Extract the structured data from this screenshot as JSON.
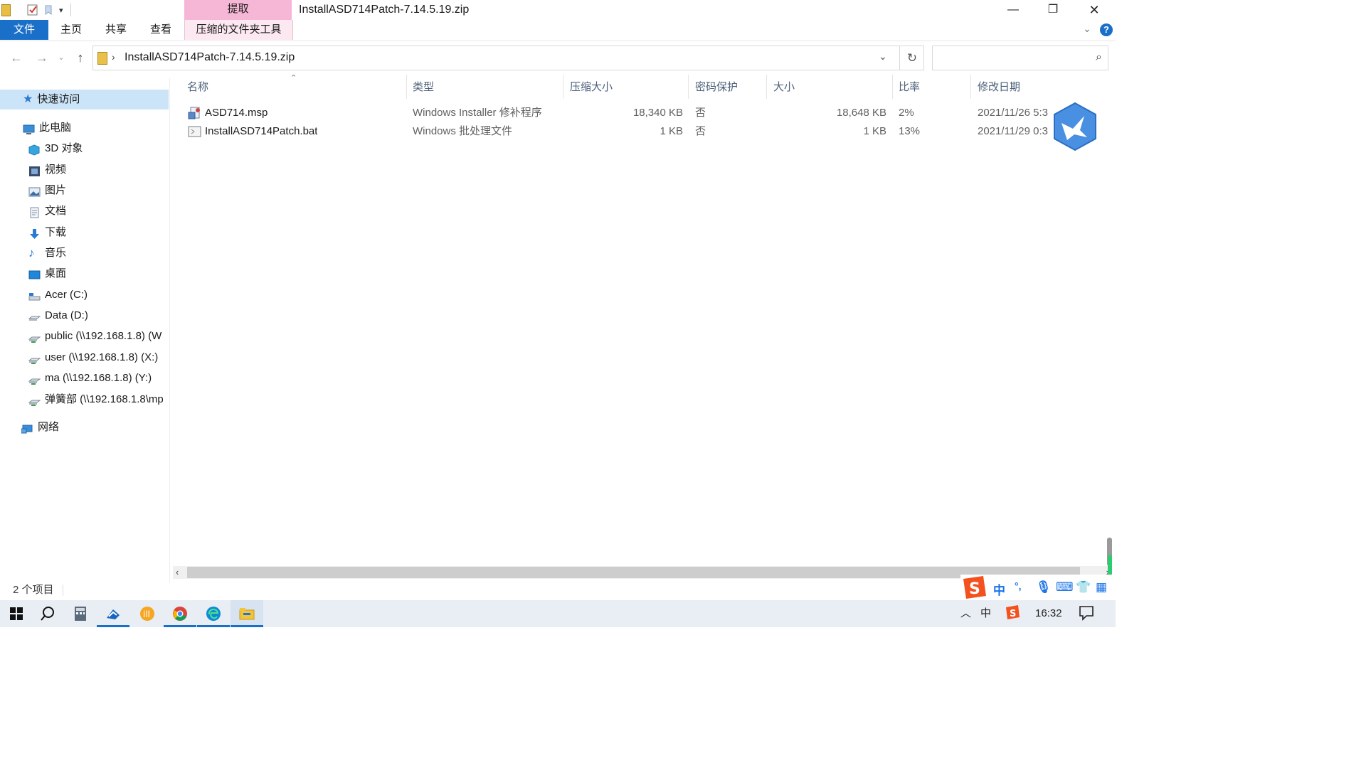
{
  "window": {
    "title": "InstallASD714Patch-7.14.5.19.zip",
    "context_tab_group": "提取",
    "controls": [
      "—",
      "❐",
      "✕"
    ]
  },
  "ribbon": {
    "tabs": [
      "文件",
      "主页",
      "共享",
      "查看",
      "压缩的文件夹工具"
    ],
    "active_tab": "文件",
    "context_color": "#f6b7d6",
    "accent": "#1a6fc9"
  },
  "navigation": {
    "address_path": "InstallASD714Patch-7.14.5.19.zip",
    "search_placeholder": ""
  },
  "sidebar": {
    "quick_access": "快速访问",
    "this_pc": "此电脑",
    "items": [
      {
        "label": "3D 对象",
        "icon": "3d-objects-icon"
      },
      {
        "label": "视频",
        "icon": "video-icon"
      },
      {
        "label": "图片",
        "icon": "pictures-icon"
      },
      {
        "label": "文档",
        "icon": "documents-icon"
      },
      {
        "label": "下载",
        "icon": "downloads-icon"
      },
      {
        "label": "音乐",
        "icon": "music-icon"
      },
      {
        "label": "桌面",
        "icon": "desktop-icon"
      },
      {
        "label": "Acer (C:)",
        "icon": "drive-icon"
      },
      {
        "label": "Data (D:)",
        "icon": "drive-icon"
      },
      {
        "label": "public (\\\\192.168.1.8) (W",
        "icon": "network-drive-icon"
      },
      {
        "label": "user (\\\\192.168.1.8) (X:)",
        "icon": "network-drive-icon"
      },
      {
        "label": "ma (\\\\192.168.1.8) (Y:)",
        "icon": "network-drive-icon"
      },
      {
        "label": "弹簧部 (\\\\192.168.1.8\\mp",
        "icon": "network-drive-icon"
      }
    ],
    "network": "网络"
  },
  "columns": [
    "名称",
    "类型",
    "压缩大小",
    "密码保护",
    "大小",
    "比率",
    "修改日期"
  ],
  "files": [
    {
      "name": "ASD714.msp",
      "type": "Windows Installer 修补程序",
      "compressed": "18,340 KB",
      "password": "否",
      "size": "18,648 KB",
      "ratio": "2%",
      "modified": "2021/11/26 5:3",
      "icon": "msp-file-icon"
    },
    {
      "name": "InstallASD714Patch.bat",
      "type": "Windows 批处理文件",
      "compressed": "1 KB",
      "password": "否",
      "size": "1 KB",
      "ratio": "13%",
      "modified": "2021/11/29 0:3",
      "icon": "bat-file-icon"
    }
  ],
  "status": {
    "item_count": "2 个项目"
  },
  "taskbar": {
    "apps": [
      "start-icon",
      "search-icon",
      "calculator-icon",
      "mail-icon",
      "app-orange-icon",
      "chrome-icon",
      "edge-icon",
      "file-explorer-icon"
    ],
    "time": "16:32",
    "ime_indicator": "中"
  },
  "ime_toolbar": {
    "mode": "中",
    "punct": "°,"
  }
}
